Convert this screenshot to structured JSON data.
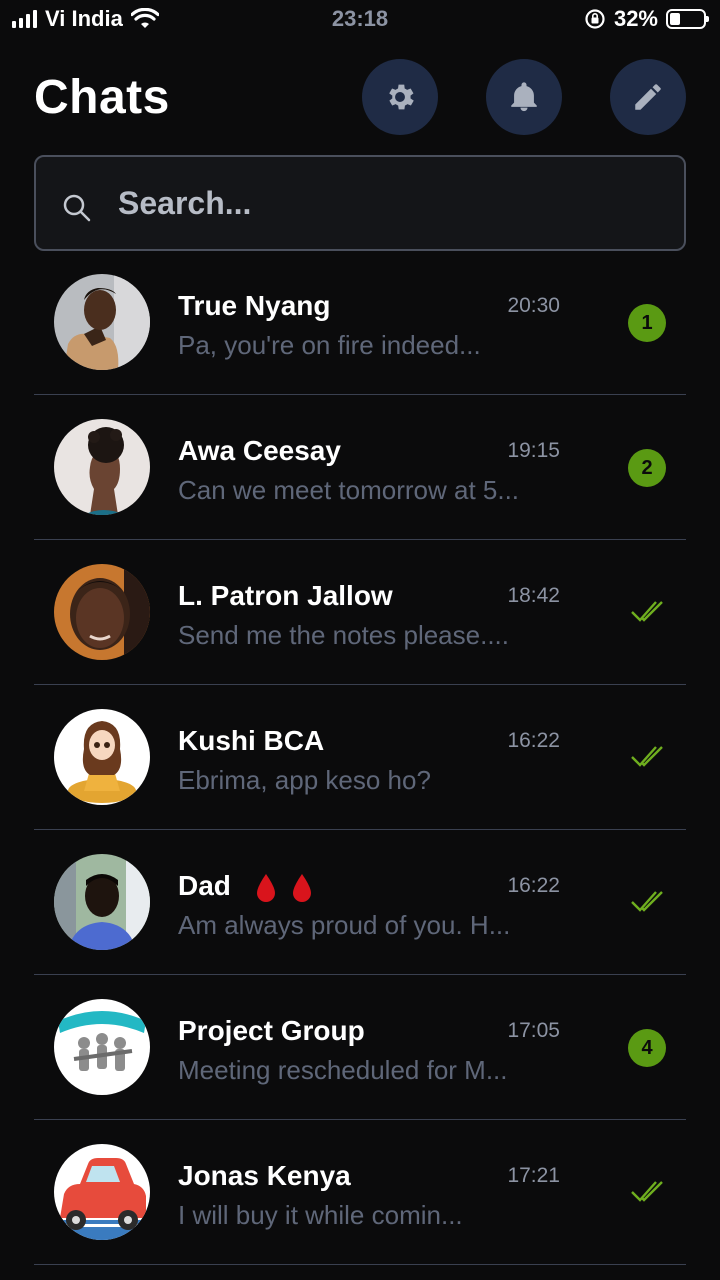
{
  "status_bar": {
    "carrier": "Vi India",
    "time": "23:18",
    "battery": "32%",
    "battery_level": 0.32
  },
  "header": {
    "title": "Chats",
    "buttons": [
      {
        "icon": "gear-icon"
      },
      {
        "icon": "bell-icon"
      },
      {
        "icon": "pencil-icon"
      }
    ]
  },
  "search": {
    "placeholder": "Search..."
  },
  "colors": {
    "background": "#0b0b0c",
    "header_button": "#1f2b45",
    "badge": "#5a9a13",
    "tick": "#6fae1f",
    "time": "#8c93a3",
    "message": "#5f6779"
  },
  "chats": [
    {
      "name": "True Nyang",
      "time": "20:30",
      "message": "Pa, you're on fire indeed...",
      "unread": "1"
    },
    {
      "name": "Awa Ceesay",
      "time": "19:15",
      "message": "Can we meet tomorrow at 5...",
      "unread": "2"
    },
    {
      "name": "L. Patron Jallow",
      "time": "18:42",
      "message": "Send me the notes please....",
      "status": "read"
    },
    {
      "name": "Kushi BCA",
      "time": "16:22",
      "message": "Ebrima, app keso ho?",
      "status": "read"
    },
    {
      "name": "Dad",
      "name_emoji": "drop-of-blood-icon x2",
      "time": "16:22",
      "message": "Am always proud of you. H...",
      "status": "read"
    },
    {
      "name": "Project Group",
      "time": "17:05",
      "message": "Meeting rescheduled for M...",
      "unread": "4"
    },
    {
      "name": "Jonas Kenya",
      "time": "17:21",
      "message": "I will buy it while comin...",
      "status": "read"
    }
  ]
}
